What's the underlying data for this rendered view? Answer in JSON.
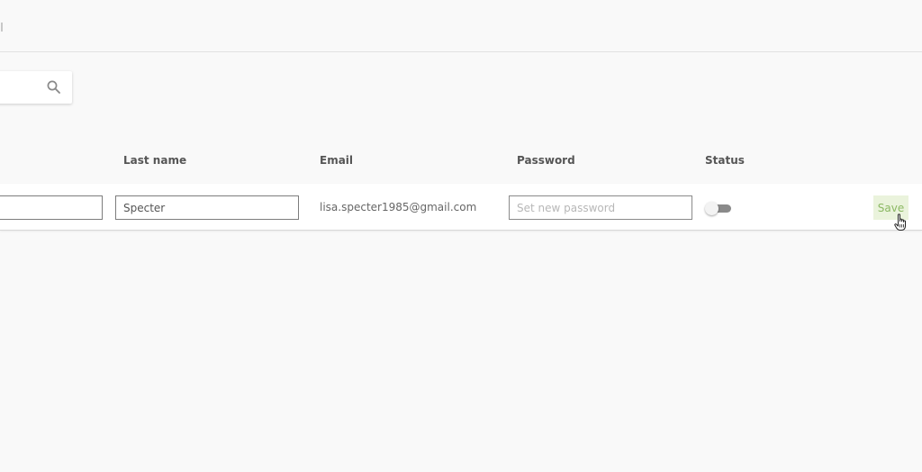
{
  "search": {
    "value": ""
  },
  "table": {
    "headers": {
      "last_name": "Last name",
      "email": "Email",
      "password": "Password",
      "status": "Status"
    },
    "row": {
      "first_name": "",
      "last_name": "Specter",
      "email": "lisa.specter1985@gmail.com",
      "password_placeholder": "Set new password",
      "status_active": false,
      "save_label": "Save"
    }
  },
  "colors": {
    "background": "#f9f9f9",
    "row_background": "#ffffff",
    "save_bg": "#eaf3dc",
    "save_text": "#8bb863",
    "toggle_track": "#8a8a8a"
  }
}
